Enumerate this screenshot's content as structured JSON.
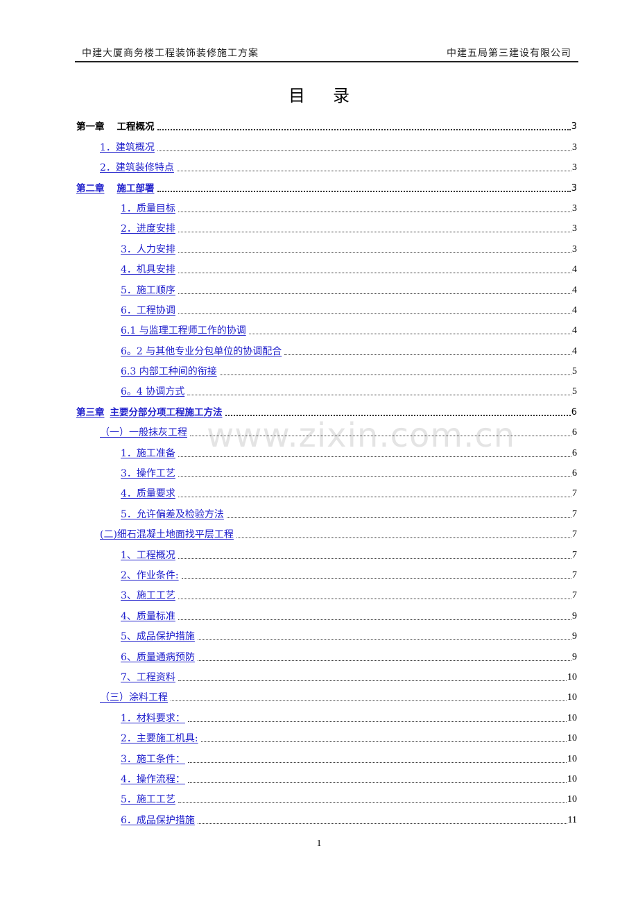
{
  "header": {
    "left": "中建大厦商务楼工程装饰装修施工方案",
    "right": "中建五局第三建设有限公司"
  },
  "title": {
    "char1": "目",
    "char2": "录"
  },
  "watermark": "www.zixin.com.cn",
  "colors": {
    "link": "#2020cc",
    "text": "#000000",
    "watermark": "#e4e4e4"
  },
  "toc": [
    {
      "level": 0,
      "type": "chapter",
      "link": false,
      "num": "第一章",
      "text": "工程概况",
      "page": "3"
    },
    {
      "level": 1,
      "type": "item",
      "link": true,
      "text": "1．建筑概况",
      "page": "3"
    },
    {
      "level": 1,
      "type": "item",
      "link": true,
      "text": "2．建筑装修特点",
      "page": "3"
    },
    {
      "level": 0,
      "type": "chapter",
      "link": true,
      "num": "第二章",
      "text": "施工部署",
      "page": "3"
    },
    {
      "level": 2,
      "type": "item",
      "link": true,
      "text": "1．质量目标",
      "page": "3"
    },
    {
      "level": 2,
      "type": "item",
      "link": true,
      "text": "2．进度安排",
      "page": "3"
    },
    {
      "level": 2,
      "type": "item",
      "link": true,
      "text": "3．人力安排",
      "page": "3"
    },
    {
      "level": 2,
      "type": "item",
      "link": true,
      "text": "4．机具安排",
      "page": "4"
    },
    {
      "level": 2,
      "type": "item",
      "link": true,
      "text": "5．施工顺序",
      "page": "4"
    },
    {
      "level": 2,
      "type": "item",
      "link": true,
      "text": "6．工程协调",
      "page": "4"
    },
    {
      "level": 2,
      "type": "item",
      "link": true,
      "text": "6.1  与监理工程师工作的协调",
      "page": "4"
    },
    {
      "level": 2,
      "type": "item",
      "link": true,
      "text": "6。2  与其他专业分包单位的协调配合",
      "page": "4"
    },
    {
      "level": 2,
      "type": "item",
      "link": true,
      "text": "6.3  内部工种间的衔接",
      "page": "5"
    },
    {
      "level": 2,
      "type": "item",
      "link": true,
      "text": "6。4  协调方式",
      "page": "5"
    },
    {
      "level": 0,
      "type": "chapter",
      "link": true,
      "num": "第三章",
      "text": "主要分部分项工程施工方法",
      "page": "6",
      "tight": true
    },
    {
      "level": 1,
      "type": "item",
      "link": true,
      "text": "（一）一般抹灰工程",
      "page": "6"
    },
    {
      "level": 2,
      "type": "item",
      "link": true,
      "text": "1．施工准备",
      "page": "6"
    },
    {
      "level": 2,
      "type": "item",
      "link": true,
      "text": "3．操作工艺",
      "page": "6"
    },
    {
      "level": 2,
      "type": "item",
      "link": true,
      "text": "4．质量要求",
      "page": "7"
    },
    {
      "level": 2,
      "type": "item",
      "link": true,
      "text": "5．允许偏差及检验方法",
      "page": "7"
    },
    {
      "level": 1,
      "type": "item",
      "link": true,
      "text": "(二)细石混凝土地面找平层工程",
      "page": "7"
    },
    {
      "level": 2,
      "type": "item",
      "link": true,
      "text": "1、工程概况",
      "page": "7"
    },
    {
      "level": 2,
      "type": "item",
      "link": true,
      "text": "2、作业条件:",
      "page": "7"
    },
    {
      "level": 2,
      "type": "item",
      "link": true,
      "text": "3、施工工艺",
      "page": "7"
    },
    {
      "level": 2,
      "type": "item",
      "link": true,
      "text": "4、质量标准",
      "page": "9"
    },
    {
      "level": 2,
      "type": "item",
      "link": true,
      "text": "5、成品保护措施",
      "page": "9"
    },
    {
      "level": 2,
      "type": "item",
      "link": true,
      "text": "6、质量通病预防",
      "page": "9"
    },
    {
      "level": 2,
      "type": "item",
      "link": true,
      "text": "7、工程资料",
      "page": "10"
    },
    {
      "level": 1,
      "type": "item",
      "link": true,
      "text": "（三）涂料工程",
      "page": "10"
    },
    {
      "level": 2,
      "type": "item",
      "link": true,
      "text": "1．材料要求： ",
      "page": "10"
    },
    {
      "level": 2,
      "type": "item",
      "link": true,
      "text": "2．主要施工机具:",
      "page": "10"
    },
    {
      "level": 2,
      "type": "item",
      "link": true,
      "text": "3．施工条件： ",
      "page": "10"
    },
    {
      "level": 2,
      "type": "item",
      "link": true,
      "text": "4．操作流程： ",
      "page": "10"
    },
    {
      "level": 2,
      "type": "item",
      "link": true,
      "text": "5．施工工艺",
      "page": "10"
    },
    {
      "level": 2,
      "type": "item",
      "link": true,
      "text": "6．成品保护措施",
      "page": "11"
    }
  ],
  "footer": {
    "page_number": "1"
  }
}
